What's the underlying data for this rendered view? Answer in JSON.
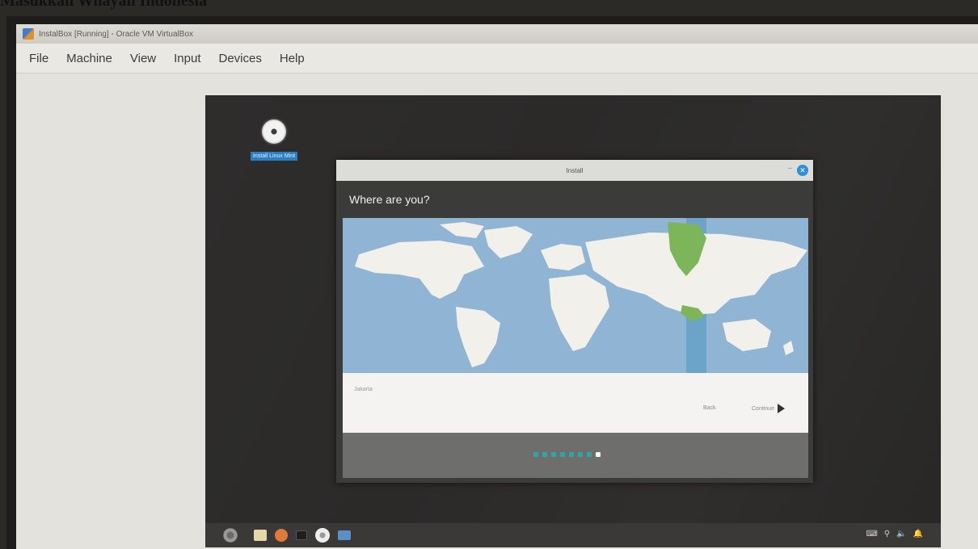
{
  "caption": "Masukkan Wilayah Indonesia",
  "virtualbox": {
    "title": "InstalBox [Running] - Oracle VM VirtualBox",
    "menu": [
      "File",
      "Machine",
      "View",
      "Input",
      "Devices",
      "Help"
    ]
  },
  "desktop": {
    "icon_label": "Install Linux Mint"
  },
  "installer": {
    "window_title": "Install",
    "minimize_glyph": "–",
    "close_glyph": "✕",
    "heading": "Where are you?",
    "location_placeholder": "Jakarta",
    "back_label": "Back",
    "continue_label": "Continue",
    "progress": {
      "total_steps": 8,
      "current_step": 8
    }
  },
  "taskbar": {
    "tray_icons": [
      "keyboard-icon",
      "network-icon",
      "volume-icon",
      "notification-icon"
    ],
    "tray_glyphs": [
      "⌨",
      "⚲",
      "🔈",
      "🔔"
    ],
    "clock": ""
  },
  "colors": {
    "map_ocean": "#8fb4d4",
    "map_land": "#f2f0ea",
    "timezone_highlight": "#6ba3c9",
    "selected_region": "#7cb55a",
    "progress_dot": "#2fa6a8"
  }
}
